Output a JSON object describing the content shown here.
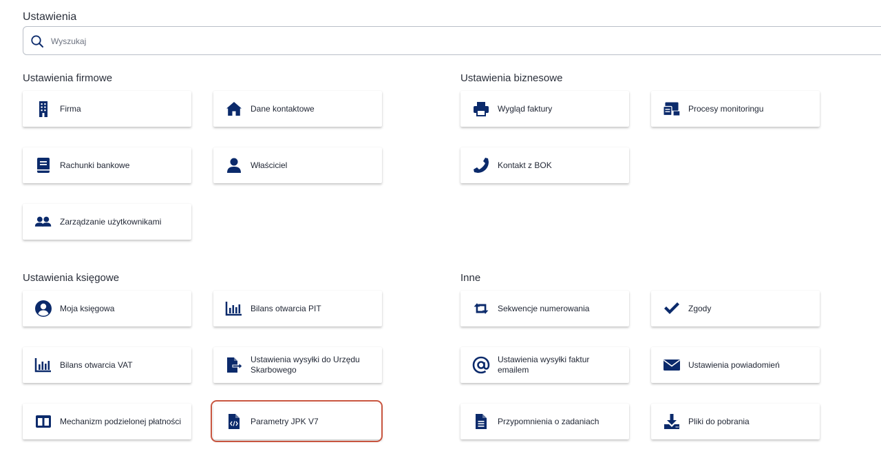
{
  "page": {
    "title": "Ustawienia"
  },
  "search": {
    "placeholder": "Wyszukaj",
    "icon": "search-icon"
  },
  "colors": {
    "icon": "#0b2a6b",
    "highlight": "#c8553f",
    "border": "#b9bec7"
  },
  "sections": {
    "firmowe": {
      "title": "Ustawienia firmowe",
      "items": [
        {
          "label": "Firma",
          "icon": "building-icon"
        },
        {
          "label": "Dane kontaktowe",
          "icon": "home-icon"
        },
        {
          "label": "Rachunki bankowe",
          "icon": "book-icon"
        },
        {
          "label": "Właściciel",
          "icon": "user-icon"
        },
        {
          "label": "Zarządzanie użytkownikami",
          "icon": "users-icon"
        }
      ]
    },
    "biznesowe": {
      "title": "Ustawienia biznesowe",
      "items": [
        {
          "label": "Wygląd faktury",
          "icon": "printer-icon"
        },
        {
          "label": "Procesy monitoringu",
          "icon": "monitoring-icon"
        },
        {
          "label": "Kontakt z BOK",
          "icon": "phone-icon"
        }
      ]
    },
    "ksiegowe": {
      "title": "Ustawienia księgowe",
      "items": [
        {
          "label": "Moja księgowa",
          "icon": "user-circle-icon"
        },
        {
          "label": "Bilans otwarcia PIT",
          "icon": "bar-chart-icon"
        },
        {
          "label": "Bilans otwarcia VAT",
          "icon": "bar-chart-icon"
        },
        {
          "label": "Ustawienia wysyłki do Urzędu Skarbowego",
          "icon": "file-export-icon"
        },
        {
          "label": "Mechanizm podzielonej płatności",
          "icon": "split-columns-icon"
        },
        {
          "label": "Parametry JPK V7",
          "icon": "file-code-icon"
        }
      ]
    },
    "inne": {
      "title": "Inne",
      "items": [
        {
          "label": "Sekwencje numerowania",
          "icon": "retweet-icon"
        },
        {
          "label": "Zgody",
          "icon": "check-icon"
        },
        {
          "label": "Ustawienia wysyłki faktur emailem",
          "icon": "at-icon"
        },
        {
          "label": "Ustawienia powiadomień",
          "icon": "envelope-icon"
        },
        {
          "label": "Przypomnienia o zadaniach",
          "icon": "document-icon"
        },
        {
          "label": "Pliki do pobrania",
          "icon": "download-icon"
        }
      ]
    }
  }
}
